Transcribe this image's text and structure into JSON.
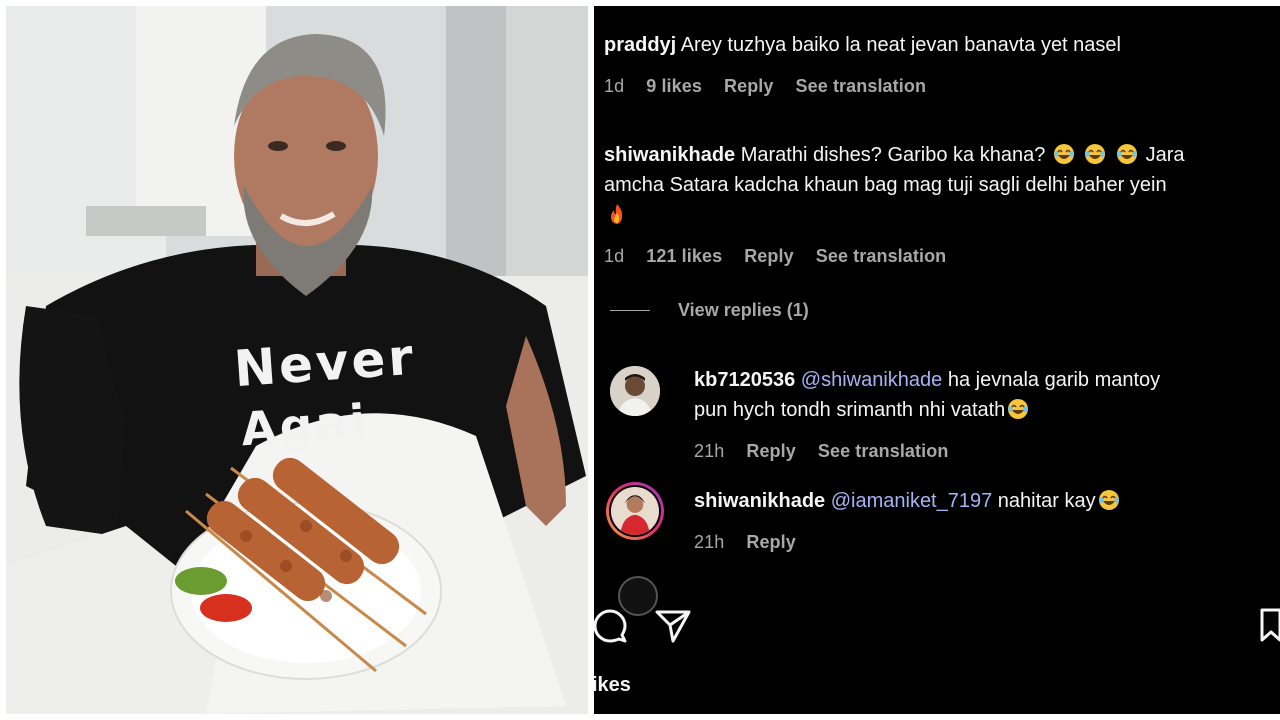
{
  "photo": {
    "shirt_text_line1": "Never",
    "shirt_text_line2": "Agai"
  },
  "comments": [
    {
      "username": "praddyj",
      "text": "Arey tuzhya baiko la neat jevan banavta yet nasel",
      "time": "1d",
      "likes": "9 likes",
      "reply_label": "Reply",
      "translate_label": "See translation"
    },
    {
      "username": "shiwanikhade",
      "text_line1": "Marathi dishes? Garibo ka khana?",
      "text_line1_after": "Jara",
      "text_line2": "amcha Satara kadcha khaun bag mag tuji sagli delhi baher yein",
      "time": "1d",
      "likes": "121 likes",
      "reply_label": "Reply",
      "translate_label": "See translation"
    }
  ],
  "view_replies": "View replies (1)",
  "replies": [
    {
      "username": "kb7120536",
      "mention": "@shiwanikhade",
      "text_line1": "ha jevnala garib mantoy",
      "text_line2": "pun hych tondh srimanth nhi vatath",
      "time": "21h",
      "reply_label": "Reply",
      "translate_label": "See translation"
    },
    {
      "username": "shiwanikhade",
      "mention": "@iamaniket_7197",
      "text": "nahitar kay",
      "time": "21h",
      "reply_label": "Reply"
    }
  ],
  "bottom": {
    "likes_partial": "ikes"
  },
  "icons": {
    "comment": "comment-bubble-icon",
    "share": "paper-plane-icon",
    "save": "bookmark-icon",
    "laugh": "tears-of-joy-emoji",
    "fire": "fire-emoji"
  },
  "colors": {
    "background": "#000000",
    "text": "#f5f5f5",
    "secondary": "#a8a8a8",
    "mention": "#a4b4f5"
  }
}
